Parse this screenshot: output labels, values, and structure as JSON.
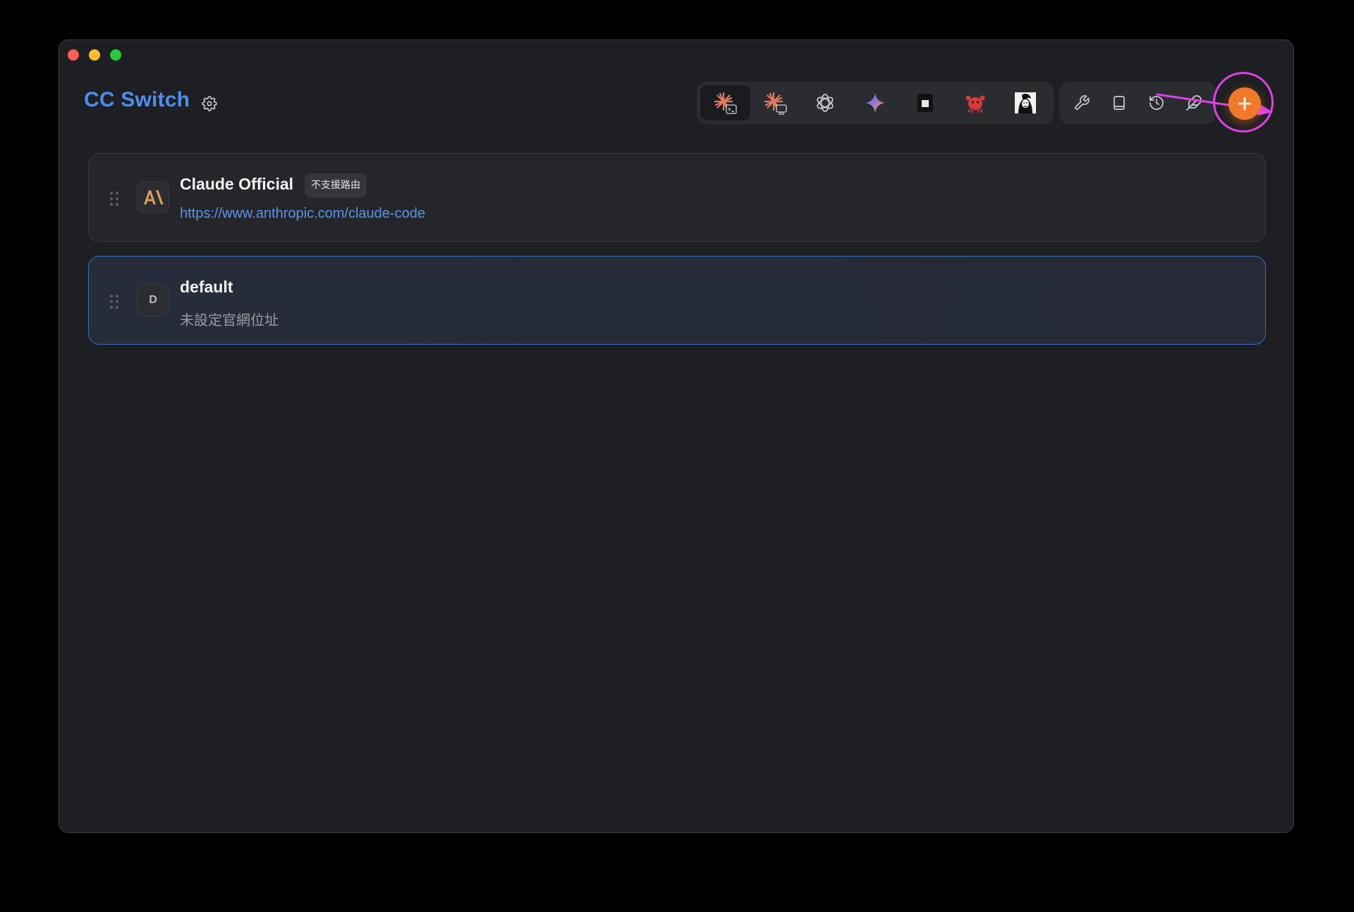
{
  "window": {
    "title": "CC Switch"
  },
  "header": {
    "settings_icon": "gear-icon",
    "apps": [
      {
        "name": "claude-code",
        "icon": "claude-terminal-icon",
        "active": true
      },
      {
        "name": "claude-desktop",
        "icon": "claude-desktop-icon",
        "active": false
      },
      {
        "name": "codex",
        "icon": "openai-icon",
        "active": false
      },
      {
        "name": "gemini",
        "icon": "gemini-icon",
        "active": false
      },
      {
        "name": "terminal",
        "icon": "square-icon",
        "active": false
      },
      {
        "name": "crab",
        "icon": "crab-icon",
        "active": false
      },
      {
        "name": "portrait",
        "icon": "portrait-icon",
        "active": false
      }
    ],
    "tools": [
      {
        "name": "tools",
        "icon": "wrench-icon"
      },
      {
        "name": "docs",
        "icon": "book-icon"
      },
      {
        "name": "history",
        "icon": "history-icon"
      },
      {
        "name": "skills",
        "icon": "feather-icon"
      }
    ],
    "add_icon": "plus-icon",
    "accent_color": "#f07a2a",
    "highlight_color": "#e040e8"
  },
  "providers": [
    {
      "name": "Claude Official",
      "badge": "不支援路由",
      "url": "https://www.anthropic.com/claude-code",
      "icon": "anthropic-icon",
      "selected": false
    },
    {
      "name": "default",
      "icon_letter": "D",
      "subtitle": "未設定官網位址",
      "selected": true
    }
  ]
}
